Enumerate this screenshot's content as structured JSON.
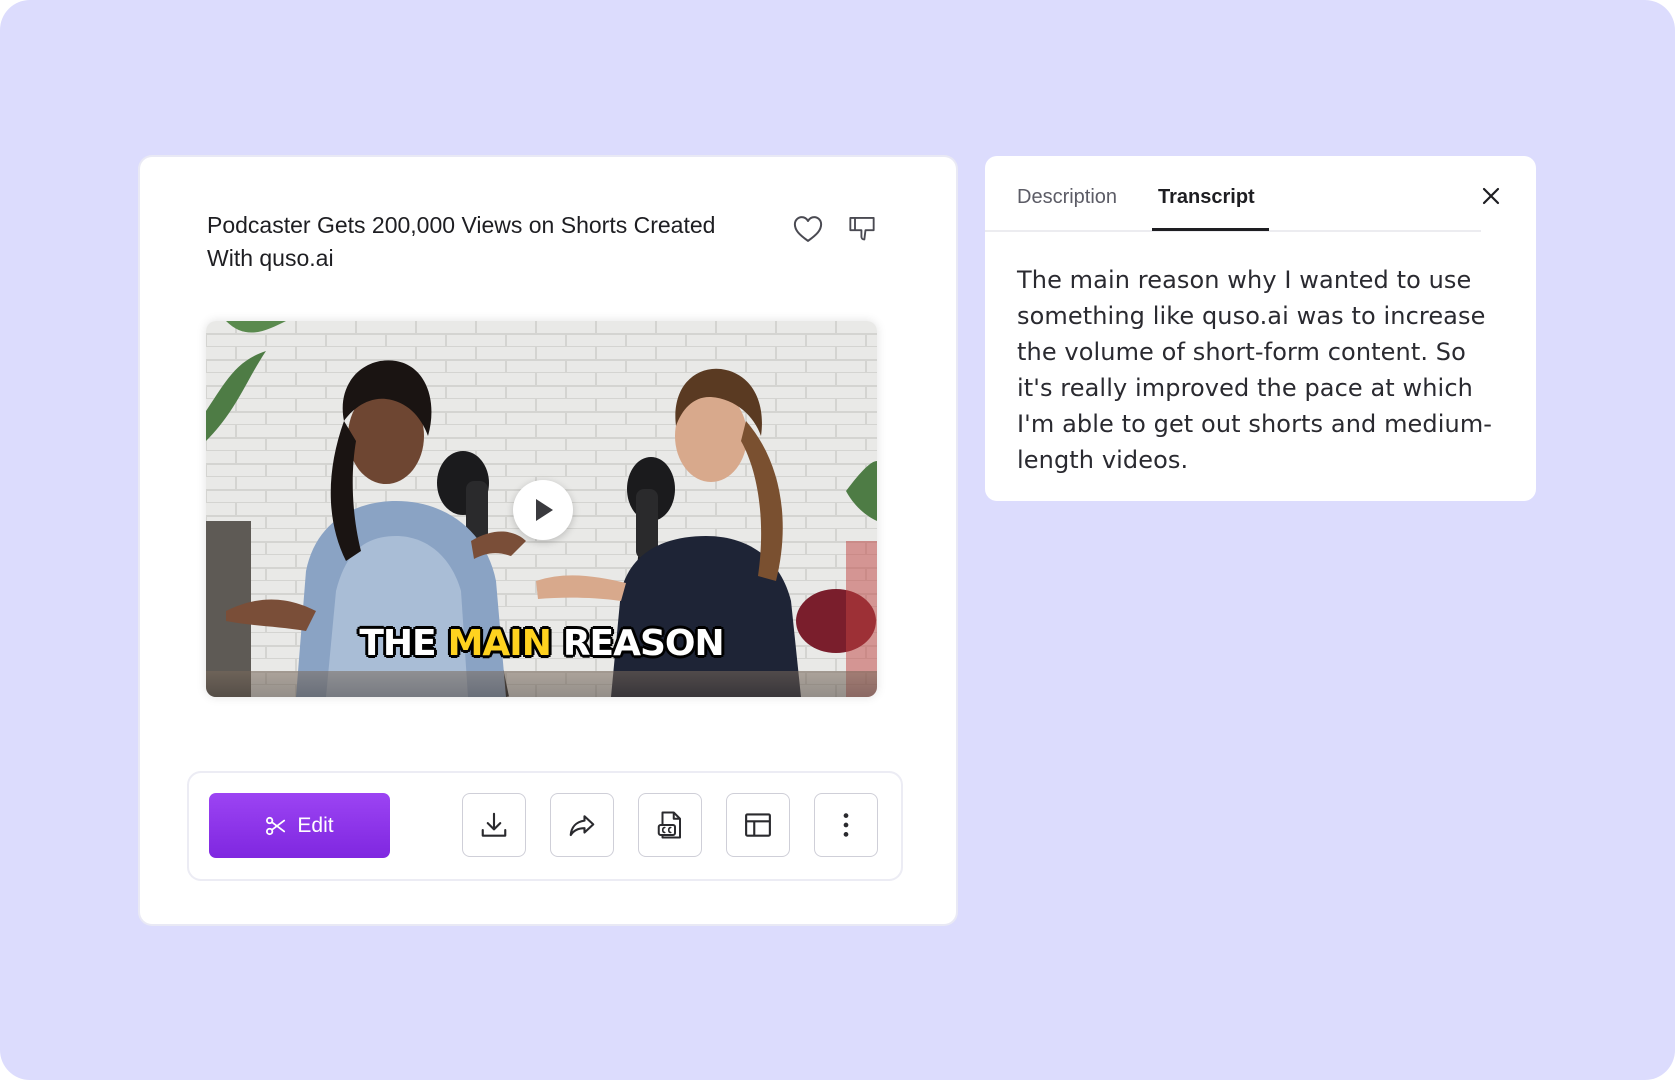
{
  "video": {
    "title": "Podcaster Gets 200,000 Views on Shorts Created With quso.ai",
    "caption": [
      "THE",
      "MAIN",
      "REASON"
    ],
    "caption_highlight_color": "#ffd21f"
  },
  "actions": {
    "edit_label": "Edit",
    "tools": [
      "download-icon",
      "share-icon",
      "captions-file-icon",
      "layout-icon",
      "more-vertical-icon"
    ]
  },
  "panel": {
    "tabs": [
      {
        "label": "Description",
        "active": false
      },
      {
        "label": "Transcript",
        "active": true
      }
    ],
    "transcript": "The main reason why I wanted to use something like quso.ai was to increase the volume of short-form content. So it's really improved the pace at which I'm able to get out shorts and medium-length videos."
  },
  "colors": {
    "background": "#dcdcfd",
    "accent": "#8a32eb",
    "text": "#1e1e22"
  }
}
